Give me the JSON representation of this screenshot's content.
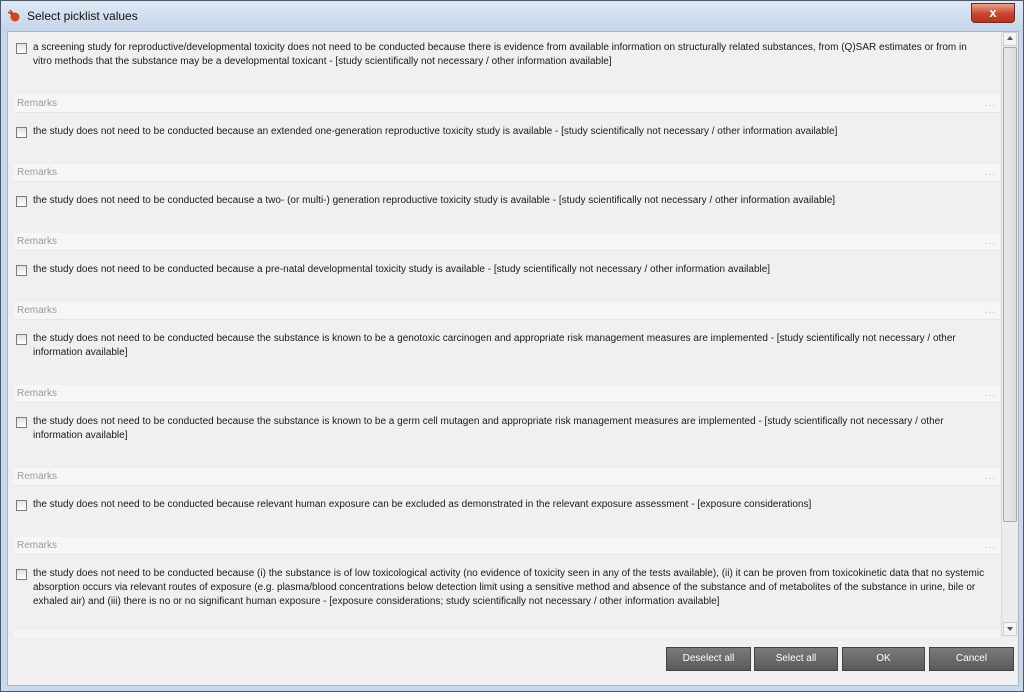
{
  "window": {
    "title": "Select picklist values",
    "close_label": "x"
  },
  "items": [
    {
      "text": "a screening study for reproductive/developmental toxicity does not need to be conducted because there is evidence from available information on structurally related substances, from (Q)SAR estimates or from in vitro methods that the substance may be a developmental toxicant - [study scientifically not necessary / other information available]"
    },
    {
      "text": "the study does not need to be conducted because an extended one-generation reproductive toxicity study is available - [study scientifically not necessary / other information available]"
    },
    {
      "text": "the study does not need to be conducted because a two- (or multi-) generation reproductive toxicity study is available - [study scientifically not necessary / other information available]"
    },
    {
      "text": "the study does not need to be conducted because a pre-natal developmental toxicity study is available - [study scientifically not necessary / other information available]"
    },
    {
      "text": "the study does not need to be conducted because the substance is known to be a genotoxic carcinogen and appropriate risk management measures are implemented - [study scientifically not necessary / other information available]"
    },
    {
      "text": "the study does not need to be conducted because the substance is known to be a germ cell mutagen and appropriate risk management measures are implemented - [study scientifically not necessary / other information available]"
    },
    {
      "text": "the study does not need to be conducted because relevant human exposure can be excluded as demonstrated in the relevant exposure assessment - [exposure considerations]"
    },
    {
      "text": "the study does not need to be conducted because (i) the substance is of low toxicological activity (no evidence of toxicity seen in any of the tests available), (ii) it can be proven from toxicokinetic data that no systemic absorption occurs via relevant routes of exposure (e.g. plasma/blood concentrations below detection limit using a sensitive method and absence of the substance and of metabolites of the substance in urine, bile or exhaled air) and (iii) there is no or no significant human exposure - [exposure considerations; study scientifically not necessary / other information available]"
    }
  ],
  "remarks_label": "Remarks",
  "remarks_ellipsis": "...",
  "buttons": {
    "deselect_all": "Deselect all",
    "select_all": "Select all",
    "ok": "OK",
    "cancel": "Cancel"
  }
}
